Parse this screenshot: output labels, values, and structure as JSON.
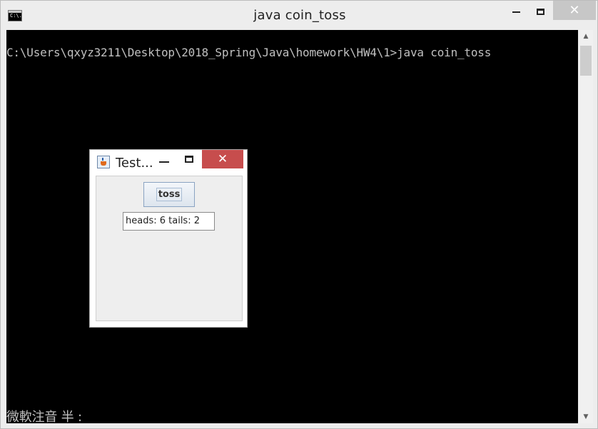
{
  "console_window": {
    "title": "java  coin_toss",
    "cmd_icon_text": "C:\\.",
    "command_line": "C:\\Users\\qxyz3211\\Desktop\\2018_Spring\\Java\\homework\\HW4\\1>java coin_toss",
    "ime_status": "微軟注音 半 :"
  },
  "swing_window": {
    "title": "Test...",
    "toss_button_label": "toss",
    "result_text": "heads: 6 tails: 2"
  },
  "icons": {
    "console": "command-prompt-icon",
    "java": "java-cup-icon",
    "minimize": "minimize-icon",
    "maximize": "maximize-icon",
    "close": "close-icon",
    "scroll_up": "scroll-up-arrow-icon",
    "scroll_down": "scroll-down-arrow-icon"
  },
  "colors": {
    "console_bg": "#000000",
    "console_text": "#c0c0c0",
    "close_active": "#c74d4d"
  }
}
